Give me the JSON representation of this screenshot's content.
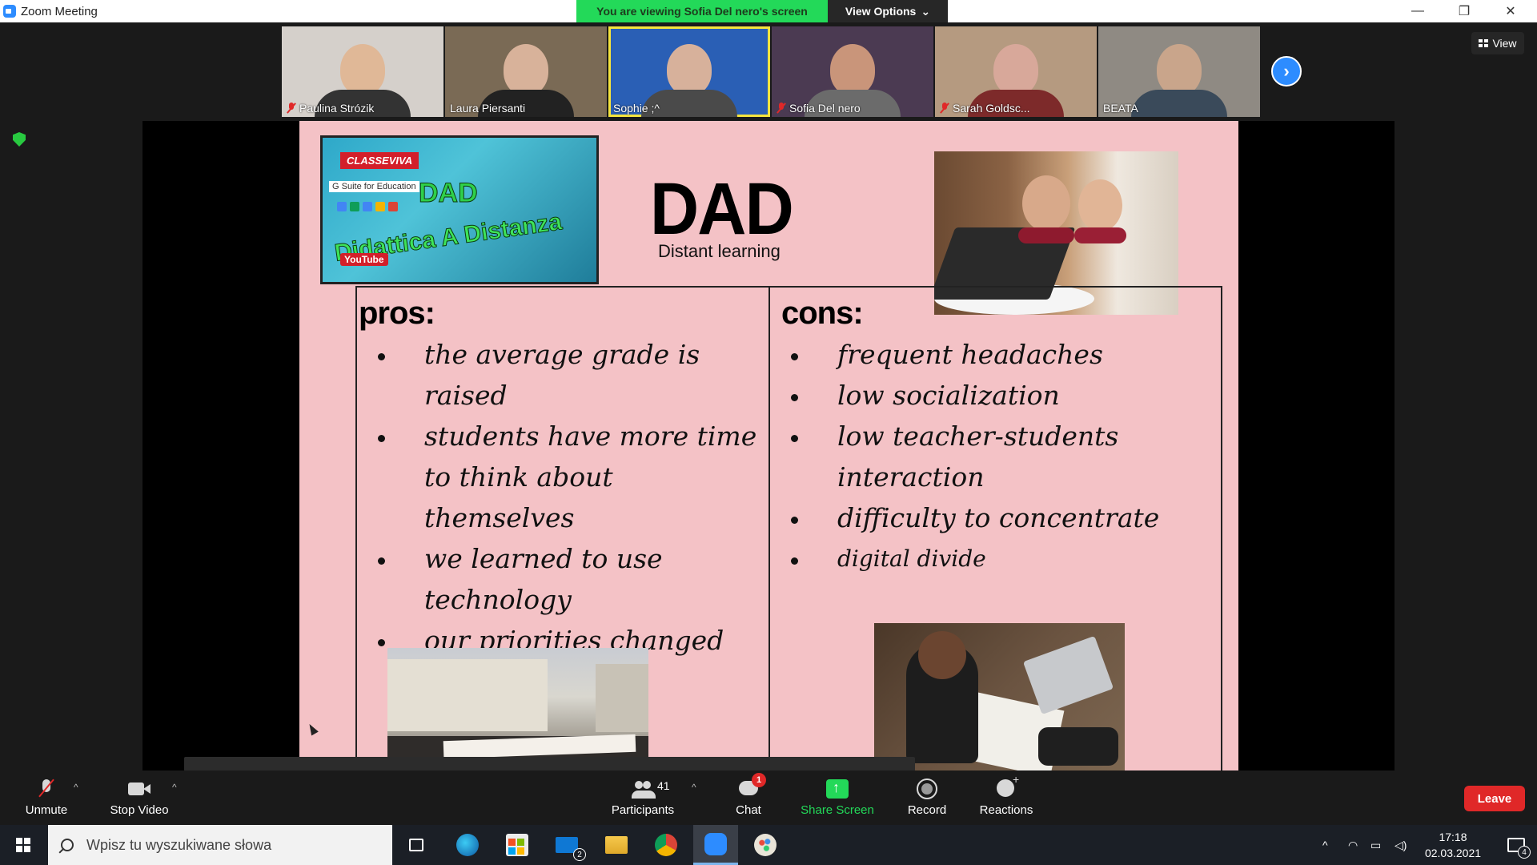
{
  "window": {
    "title": "Zoom Meeting",
    "banner": "You are viewing Sofia Del nero's screen",
    "view_options": "View Options",
    "minimize": "—",
    "restore": "❐",
    "close": "✕"
  },
  "participants": [
    {
      "name": "Paulina Strózik",
      "muted": true,
      "skin": "#e0b897",
      "bg": "#d5d0cb",
      "clothes": "#333333"
    },
    {
      "name": "Laura Piersanti",
      "muted": false,
      "skin": "#d8b29a",
      "bg": "#7a6a55",
      "clothes": "#222222"
    },
    {
      "name": "Sophie ;^",
      "muted": false,
      "skin": "#d7b19b",
      "bg": "#2a5fb5",
      "clothes": "#4a4a4a",
      "active": true
    },
    {
      "name": "Sofia Del nero",
      "muted": true,
      "skin": "#c9957a",
      "bg": "#4b3a52",
      "clothes": "#6b6b6b"
    },
    {
      "name": "Sarah Goldsc...",
      "muted": true,
      "skin": "#d8a89a",
      "bg": "#b59a80",
      "clothes": "#7d2a2a"
    },
    {
      "name": "BEATA",
      "muted": false,
      "skin": "#c9a58b",
      "bg": "#8f8a83",
      "clothes": "#3a4a5a"
    }
  ],
  "view_button": "View",
  "slide": {
    "logo": {
      "brand": "CLASSEVIVA",
      "gsuite": "G Suite for Education",
      "dad": "DAD",
      "didattica": "Didattica A Distanza",
      "youtube": "YouTube"
    },
    "title": "DAD",
    "subtitle": "Distant learning",
    "pros_heading": "pros:",
    "pros": [
      "the average grade is raised",
      "students have more time to think about themselves",
      "we learned to use technology",
      "our priorities changed"
    ],
    "cons_heading": "cons:",
    "cons": [
      "frequent headaches",
      "low socialization",
      "low  teacher-students interaction",
      "difficulty to concentrate",
      "digital divide"
    ]
  },
  "toolbar": {
    "unmute": "Unmute",
    "stop_video": "Stop Video",
    "participants": "Participants",
    "participants_count": "41",
    "chat": "Chat",
    "chat_badge": "1",
    "share_screen": "Share Screen",
    "record": "Record",
    "reactions": "Reactions",
    "leave": "Leave"
  },
  "taskbar": {
    "search_placeholder": "Wpisz tu wyszukiwane słowa",
    "mail_badge": "2",
    "time": "17:18",
    "date": "02.03.2021",
    "notif_count": "4"
  },
  "colors": {
    "accent": "#2d8cff",
    "green": "#23d959",
    "leave": "#e02828",
    "slide_bg": "#f4c2c6"
  }
}
